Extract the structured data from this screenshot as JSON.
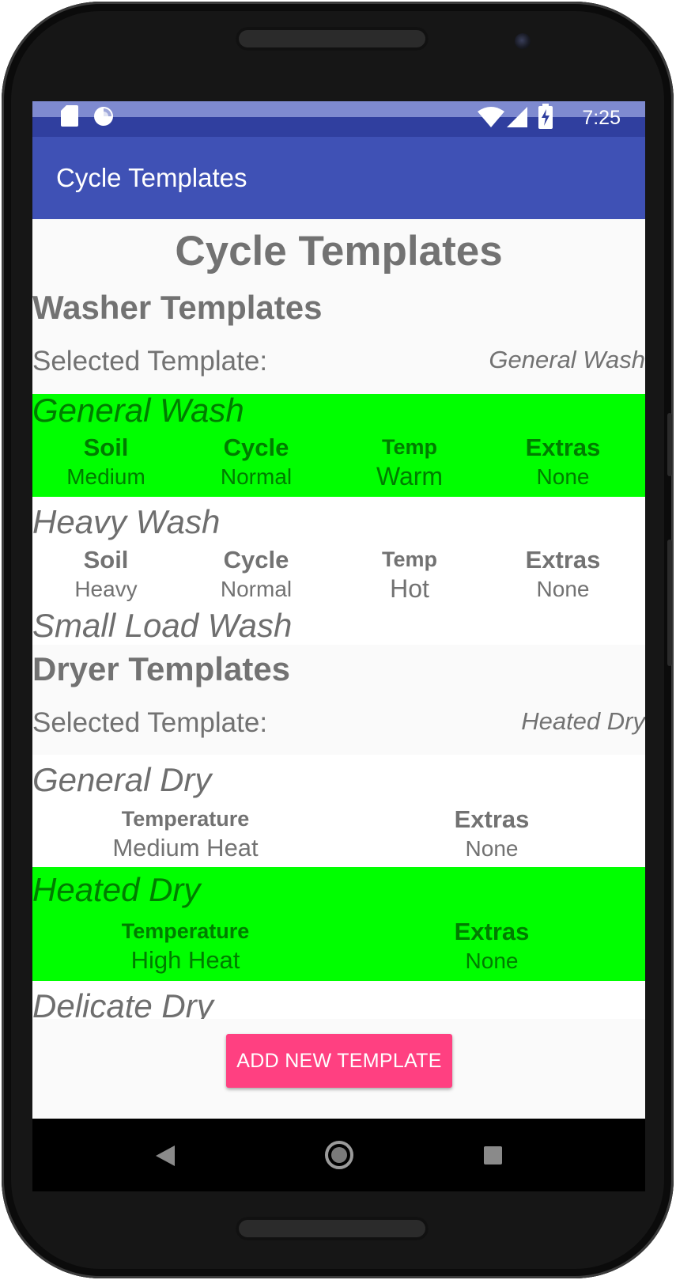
{
  "status_bar": {
    "time": "7:25",
    "icons": [
      "sd-card-icon",
      "sync-icon",
      "wifi-icon",
      "signal-icon",
      "battery-charging-icon"
    ]
  },
  "app_bar": {
    "title": "Cycle Templates"
  },
  "page_title": "Cycle Templates",
  "washer": {
    "section_title": "Washer Templates",
    "selected_label": "Selected Template:",
    "selected_value": "General Wash",
    "templates": [
      {
        "name": "General Wash",
        "selected": true,
        "soil_label": "Soil",
        "soil": "Medium",
        "cycle_label": "Cycle",
        "cycle": "Normal",
        "temp_label": "Temp",
        "temp": "Warm",
        "extras_label": "Extras",
        "extras": "None"
      },
      {
        "name": "Heavy Wash",
        "selected": false,
        "soil_label": "Soil",
        "soil": "Heavy",
        "cycle_label": "Cycle",
        "cycle": "Normal",
        "temp_label": "Temp",
        "temp": "Hot",
        "extras_label": "Extras",
        "extras": "None"
      },
      {
        "name": "Small Load Wash",
        "selected": false
      }
    ]
  },
  "dryer": {
    "section_title": "Dryer Templates",
    "selected_label": "Selected Template:",
    "selected_value": "Heated Dry",
    "templates": [
      {
        "name": "General Dry",
        "selected": false,
        "temperature_label": "Temperature",
        "temperature": "Medium Heat",
        "extras_label": "Extras",
        "extras": "None"
      },
      {
        "name": "Heated Dry",
        "selected": true,
        "temperature_label": "Temperature",
        "temperature": "High Heat",
        "extras_label": "Extras",
        "extras": "None"
      },
      {
        "name": "Delicate Dry",
        "selected": false
      }
    ]
  },
  "add_button_label": "ADD NEW TEMPLATE",
  "nav_bar": {
    "icons": [
      "back-icon",
      "home-icon",
      "recents-icon"
    ]
  },
  "colors": {
    "primary": "#3f51b5",
    "primary_dark": "#303f9f",
    "accent": "#ff4081",
    "selected_highlight": "#00ff00",
    "selected_text": "#007c00",
    "text_grey": "#727272"
  }
}
